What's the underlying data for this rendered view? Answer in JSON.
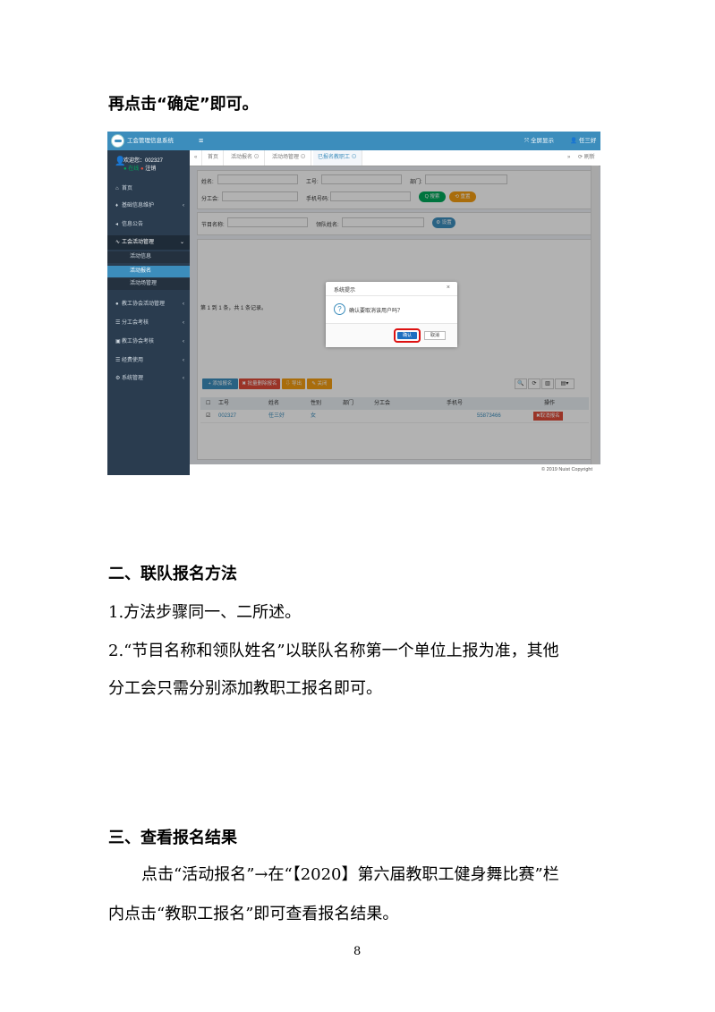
{
  "intro": "再点击“确定”即可。",
  "screenshot": {
    "app_title": "工会管理信息系统",
    "user": {
      "welcome": "欢迎您：002327",
      "online": "● 在线",
      "logout": "注销"
    },
    "topbar": {
      "menu_icon": "≡",
      "fullscreen": "全屏显示",
      "username": "任三好"
    },
    "nav": {
      "home": "首页",
      "basic_info": "基础信息维护",
      "notice": "信息公告",
      "union_activity": "工会活动管理",
      "activity_info": "活动信息",
      "activity_signup": "活动报名",
      "activity_site": "活动场管理",
      "teacher_assoc": "教工协会活动管理",
      "branch_assess": "分工会考核",
      "teacher_assess": "教工协会考核",
      "expense": "经费使用",
      "system": "系统管理"
    },
    "tabs": {
      "back": "«",
      "home": "首页",
      "t1": "活动报名 ⊙",
      "t2": "活动场管理 ⊙",
      "t3": "已报名教职工 ⊙",
      "fwd": "»",
      "refresh": "⟳ 刷新"
    },
    "search": {
      "name": "姓名:",
      "job_no": "工号:",
      "dept": "部门:",
      "branch": "分工会:",
      "phone": "手机号码:",
      "search_btn": "Q 搜索",
      "reset_btn": "⟲ 重置",
      "program": "节目名称:",
      "leader": "领队姓名:",
      "set_btn": "⚙ 设置"
    },
    "toolbar": {
      "add": "+ 添加报名",
      "batch_delete": "✖ 批量删除报名",
      "export": "⇩ 导出",
      "close": "✎ 关闭"
    },
    "tools": {
      "search": "🔍",
      "refresh": "⟳",
      "columns": "▥",
      "menu": "▤▾"
    },
    "table": {
      "headers": {
        "job_no": "工号",
        "name": "姓名",
        "gender": "性别",
        "dept": "部门",
        "branch": "分工会",
        "phone": "手机号",
        "op": "操作"
      },
      "row": {
        "job_no": "002327",
        "name": "任三好",
        "gender": "女",
        "phone": "55873466",
        "op": "✖取消报名"
      }
    },
    "pager": "第 1 到 1 条，共 1 条记录。",
    "dialog": {
      "title": "系统提示",
      "close": "×",
      "icon": "?",
      "message": "确认要取消该用户吗？",
      "ok": "确认",
      "cancel": "取消"
    },
    "footer": "© 2019 Nuist Copyright"
  },
  "section2": {
    "heading": "二、联队报名方法",
    "p1": "1.方法步骤同一、二所述。",
    "p2a": "2.“节目名称和领队姓名”以联队名称第一个单位上报为准，其他",
    "p2b": "分工会只需分别添加教职工报名即可。"
  },
  "section3": {
    "heading": "三、查看报名结果",
    "p1a": "点击“活动报名”→在“【2020】第六届教职工健身舞比赛”栏",
    "p1b": "内点击“教职工报名”即可查看报名结果。"
  },
  "page_number": "8"
}
